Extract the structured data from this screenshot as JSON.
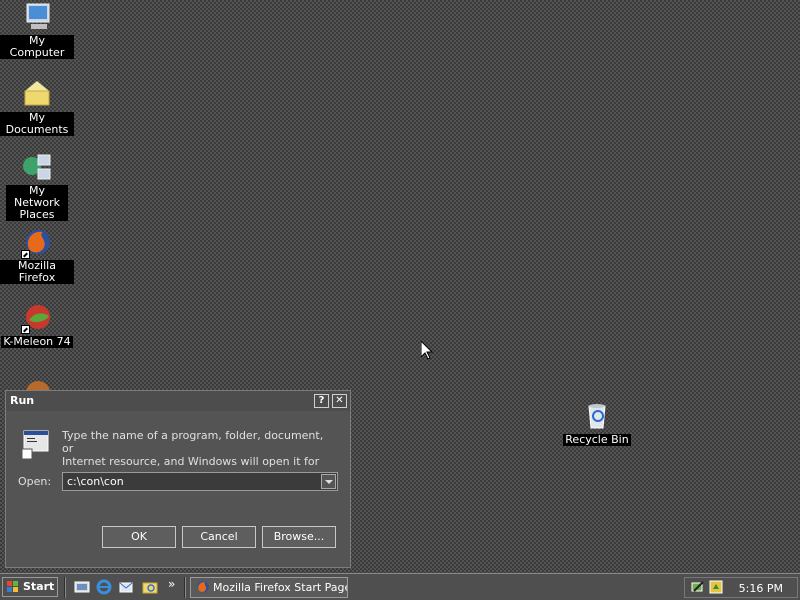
{
  "desktop": {
    "icons": [
      {
        "label": "My Computer",
        "icon": "my-computer-icon"
      },
      {
        "label": "My Documents",
        "icon": "my-documents-icon"
      },
      {
        "label_line1": "My Network",
        "label_line2": "Places",
        "icon": "my-network-places-icon"
      },
      {
        "label": "Mozilla Firefox",
        "icon": "firefox-icon"
      },
      {
        "label": "K-Meleon 74",
        "icon": "k-meleon-icon"
      },
      {
        "label": "Recycle Bin",
        "icon": "recycle-bin-icon"
      }
    ]
  },
  "run_dialog": {
    "title": "Run",
    "help_btn": "?",
    "close_btn": "✕",
    "prompt_line1": "Type the name of a program, folder, document, or",
    "prompt_line2": "Internet resource, and Windows will open it for you.",
    "open_label": "Open:",
    "open_value": "c:\\con\\con",
    "ok": "OK",
    "cancel": "Cancel",
    "browse": "Browse..."
  },
  "taskbar": {
    "start_label": "Start",
    "more": "»",
    "task_firefox": "Mozilla Firefox Start Page...",
    "clock": "5:16 PM"
  },
  "colors": {
    "desktop_dark": "#3a3a3a",
    "desktop_light": "#545454",
    "dialog_bg": "#545454",
    "taskbar_bg": "#4f4f4f"
  }
}
